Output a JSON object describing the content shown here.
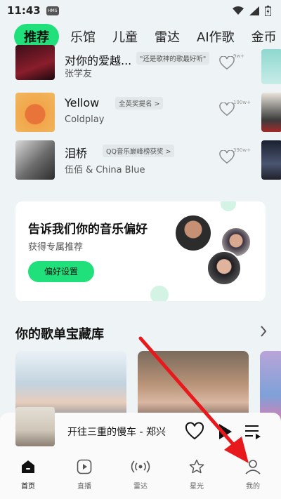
{
  "status_bar": {
    "time": "11:43",
    "badge": "HMS"
  },
  "tabs": [
    "推荐",
    "乐馆",
    "儿童",
    "雷达",
    "AI作歌",
    "金币"
  ],
  "songs": [
    {
      "title": "对你的爱越...",
      "tag": "\"还是歌神的歌最好听\"",
      "artist": "张学友",
      "count": "9w+"
    },
    {
      "title": "Yellow",
      "tag": "全英奖提名 >",
      "artist": "Coldplay",
      "count": "190w+"
    },
    {
      "title": "泪桥",
      "tag": "QQ音乐巅峰榜获奖 >",
      "artist": "伍佰 & China Blue",
      "count": "390w+"
    }
  ],
  "preference": {
    "title": "告诉我们你的音乐偏好",
    "subtitle": "获得专属推荐",
    "button": "偏好设置"
  },
  "section": {
    "title": "你的歌单宝藏库"
  },
  "mini_player": {
    "title": "开往三重的慢车 - 郑兴"
  },
  "bottom_nav": [
    {
      "label": "首页",
      "icon": "home-icon"
    },
    {
      "label": "直播",
      "icon": "play-box-icon"
    },
    {
      "label": "雷达",
      "icon": "radar-icon"
    },
    {
      "label": "星光",
      "icon": "star-icon"
    },
    {
      "label": "我的",
      "icon": "user-icon"
    }
  ],
  "colors": {
    "accent": "#1fe07a",
    "annotation_arrow": "#e8191c"
  }
}
